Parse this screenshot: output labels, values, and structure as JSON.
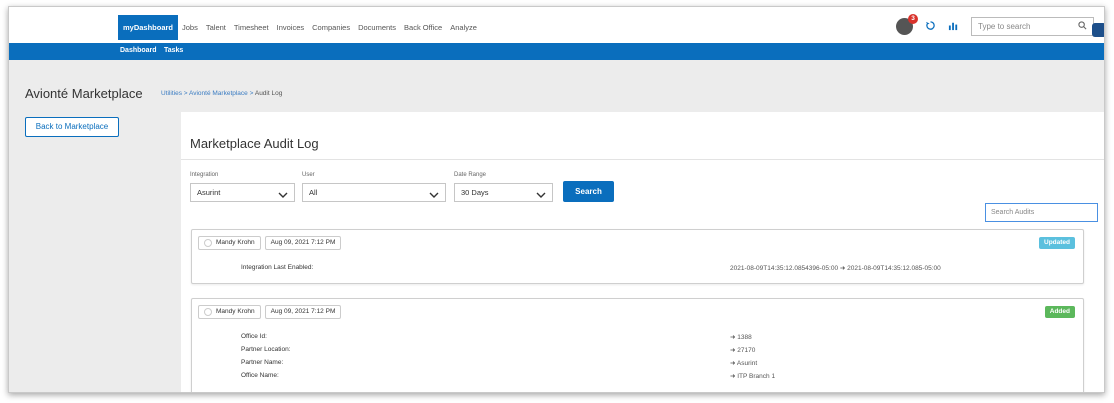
{
  "nav": {
    "items": [
      "myDashboard",
      "Jobs",
      "Talent",
      "Timesheet",
      "Invoices",
      "Companies",
      "Documents",
      "Back Office",
      "Analyze"
    ],
    "notification_count": "3",
    "search_placeholder": "Type to search"
  },
  "subnav": {
    "items": [
      "Dashboard",
      "Tasks"
    ]
  },
  "header": {
    "app_title": "Avionté Marketplace",
    "breadcrumb": [
      "Utilities",
      "Avionté Marketplace",
      "Audit Log"
    ]
  },
  "sidebar": {
    "back_button": "Back to Marketplace"
  },
  "main": {
    "title": "Marketplace Audit Log",
    "filters": {
      "integration": {
        "label": "Integration",
        "value": "Asurint"
      },
      "user": {
        "label": "User",
        "value": "All"
      },
      "date_range": {
        "label": "Date Range",
        "value": "30 Days"
      },
      "search_button": "Search"
    },
    "audit_search_placeholder": "Search Audits",
    "entries": [
      {
        "user": "Mandy Krohn",
        "date": "Aug 09, 2021 7:12 PM",
        "status": "Updated",
        "status_color": "#5bc0de",
        "rows": [
          {
            "label": "Integration Last Enabled:",
            "value": "2021-08-09T14:35:12.0854396-05:00 ➜ 2021-08-09T14:35:12.085-05:00"
          }
        ]
      },
      {
        "user": "Mandy Krohn",
        "date": "Aug 09, 2021 7:12 PM",
        "status": "Added",
        "status_color": "#5cb85c",
        "rows": [
          {
            "label": "Office Id:",
            "value": "➜ 1388"
          },
          {
            "label": "Partner Location:",
            "value": "➜ 27170"
          },
          {
            "label": "Partner Name:",
            "value": "➜ Asurint"
          },
          {
            "label": "Office Name:",
            "value": "➜ ITP Branch 1"
          }
        ]
      }
    ]
  },
  "colors": {
    "primary": "#0a6ebd",
    "updated": "#5bc0de",
    "added": "#5cb85c",
    "badge": "#d9322b"
  }
}
